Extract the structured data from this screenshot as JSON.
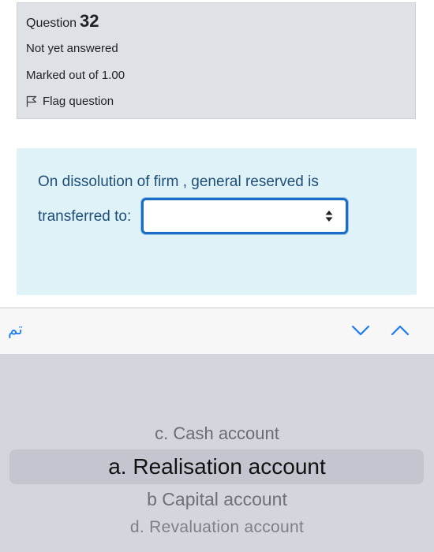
{
  "question_info": {
    "label": "Question",
    "number": "32",
    "state": "Not yet answered",
    "grade": "Marked out of 1.00",
    "flag_label": "Flag question"
  },
  "question": {
    "text_line1": "On dissolution of firm , general reserved is",
    "text_line2": "transferred to:",
    "selected_value": ""
  },
  "keyboard_bar": {
    "done_label": "تم",
    "prev_icon": "chevron-down-icon",
    "next_icon": "chevron-up-icon"
  },
  "picker": {
    "options": [
      "c. Cash account",
      "a. Realisation account",
      "b Capital account",
      "d. Revaluation account"
    ],
    "selected_index": 1
  },
  "colors": {
    "info_bg": "#dee2e6",
    "content_bg": "#def2f8",
    "question_text": "#1f4e79",
    "select_border": "#1a6cc4",
    "ios_blue": "#1a7cf0",
    "picker_bg": "#d3d6dd"
  }
}
